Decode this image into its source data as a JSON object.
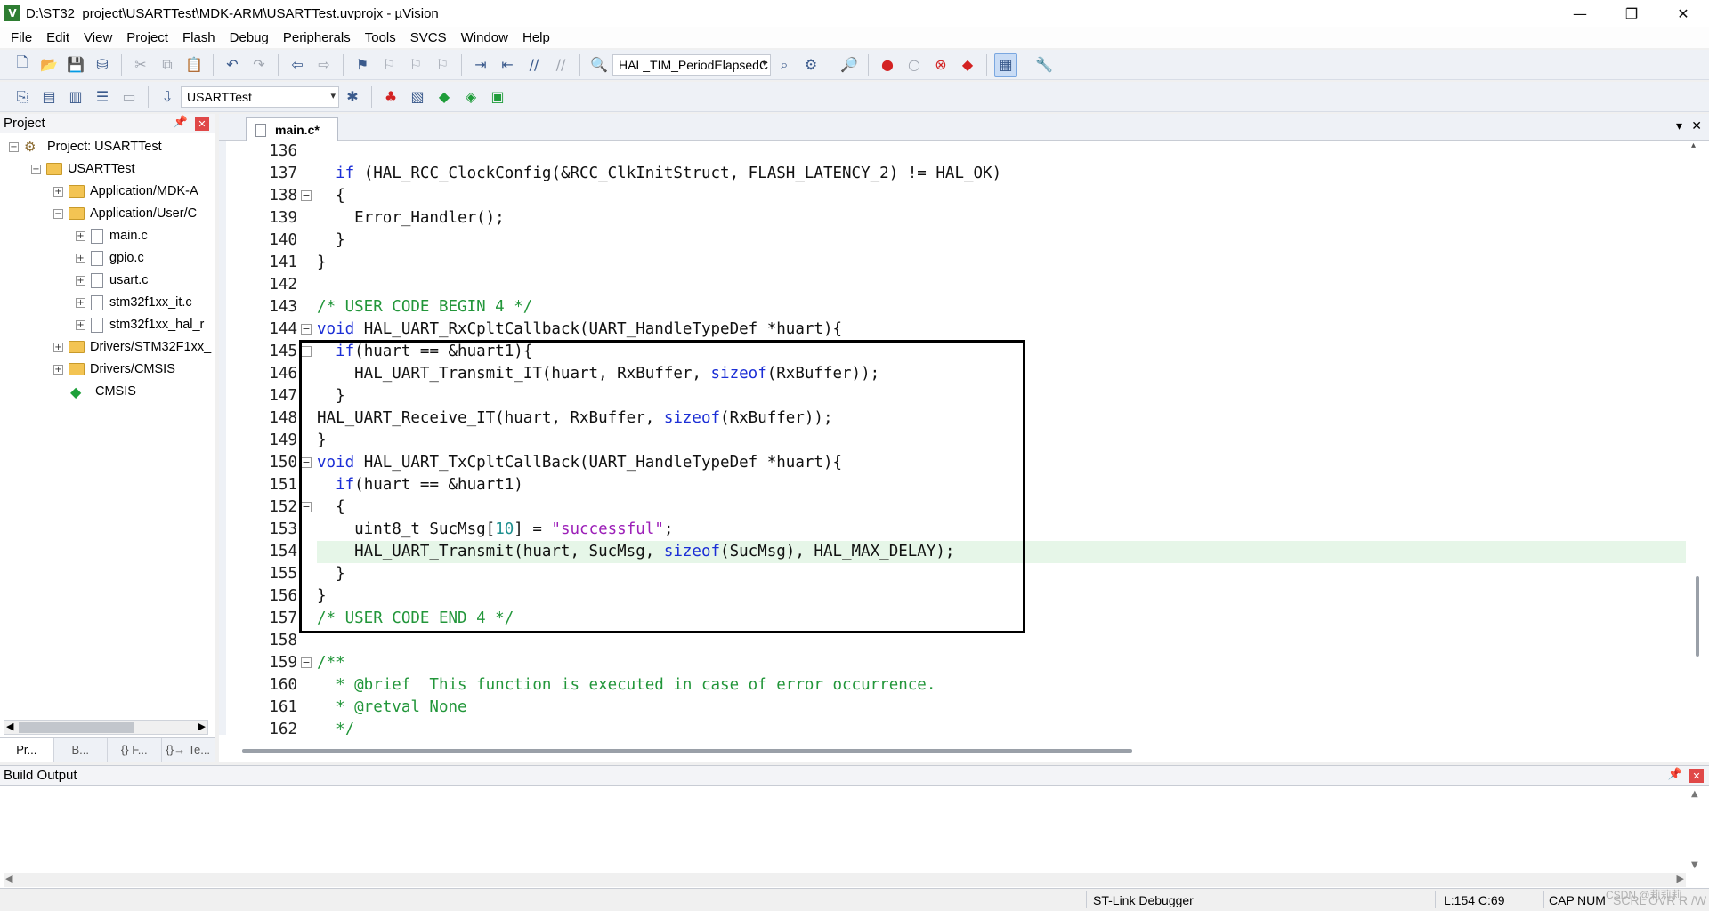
{
  "window": {
    "title": "D:\\ST32_project\\USARTTest\\MDK-ARM\\USARTTest.uvprojx - µVision",
    "app_icon": "V",
    "controls": {
      "minimize": "—",
      "restore": "❐",
      "close": "✕"
    }
  },
  "menu": [
    "File",
    "Edit",
    "View",
    "Project",
    "Flash",
    "Debug",
    "Peripherals",
    "Tools",
    "SVCS",
    "Window",
    "Help"
  ],
  "toolbar1": {
    "function_combo": "HAL_TIM_PeriodElapsedC"
  },
  "toolbar2": {
    "target_combo": "USARTTest"
  },
  "project_panel": {
    "title": "Project",
    "tree": [
      {
        "label": "Project: USARTTest",
        "type": "project"
      },
      {
        "label": "USARTTest",
        "type": "target"
      },
      {
        "label": "Application/MDK-A",
        "type": "folder"
      },
      {
        "label": "Application/User/C",
        "type": "folder"
      },
      {
        "label": "main.c",
        "type": "file"
      },
      {
        "label": "gpio.c",
        "type": "file"
      },
      {
        "label": "usart.c",
        "type": "file"
      },
      {
        "label": "stm32f1xx_it.c",
        "type": "file"
      },
      {
        "label": "stm32f1xx_hal_r",
        "type": "file"
      },
      {
        "label": "Drivers/STM32F1xx_",
        "type": "folder"
      },
      {
        "label": "Drivers/CMSIS",
        "type": "folder"
      },
      {
        "label": "CMSIS",
        "type": "component"
      }
    ],
    "tabs": [
      "Pr...",
      "B...",
      "{} F...",
      "{}→ Te..."
    ]
  },
  "editor": {
    "tab_label": "main.c*",
    "lines": [
      {
        "n": "136",
        "code": ""
      },
      {
        "n": "137",
        "code": "  if (HAL_RCC_ClockConfig(&RCC_ClkInitStruct, FLASH_LATENCY_2) != HAL_OK)"
      },
      {
        "n": "138",
        "code": "  {"
      },
      {
        "n": "139",
        "code": "    Error_Handler();"
      },
      {
        "n": "140",
        "code": "  }"
      },
      {
        "n": "141",
        "code": "}"
      },
      {
        "n": "142",
        "code": ""
      },
      {
        "n": "143",
        "code": "/* USER CODE BEGIN 4 */"
      },
      {
        "n": "144",
        "code": "void HAL_UART_RxCpltCallback(UART_HandleTypeDef *huart){"
      },
      {
        "n": "145",
        "code": "  if(huart == &huart1){"
      },
      {
        "n": "146",
        "code": "    HAL_UART_Transmit_IT(huart, RxBuffer, sizeof(RxBuffer));"
      },
      {
        "n": "147",
        "code": "  }"
      },
      {
        "n": "148",
        "code": "HAL_UART_Receive_IT(huart, RxBuffer, sizeof(RxBuffer));"
      },
      {
        "n": "149",
        "code": "}"
      },
      {
        "n": "150",
        "code": "void HAL_UART_TxCpltCallBack(UART_HandleTypeDef *huart){"
      },
      {
        "n": "151",
        "code": "  if(huart == &huart1)"
      },
      {
        "n": "152",
        "code": "  {"
      },
      {
        "n": "153",
        "code": "    uint8_t SucMsg[10] = \"successful\";"
      },
      {
        "n": "154",
        "code": "    HAL_UART_Transmit(huart, SucMsg, sizeof(SucMsg), HAL_MAX_DELAY);"
      },
      {
        "n": "155",
        "code": "  }"
      },
      {
        "n": "156",
        "code": "}"
      },
      {
        "n": "157",
        "code": "/* USER CODE END 4 */"
      },
      {
        "n": "158",
        "code": ""
      },
      {
        "n": "159",
        "code": "/**"
      },
      {
        "n": "160",
        "code": "  * @brief  This function is executed in case of error occurrence."
      },
      {
        "n": "161",
        "code": "  * @retval None"
      },
      {
        "n": "162",
        "code": "  */"
      }
    ],
    "current_line": "154"
  },
  "build_output": {
    "title": "Build Output"
  },
  "statusbar": {
    "debugger": "ST-Link Debugger",
    "position": "L:154 C:69",
    "cap": "CAP",
    "num": "NUM",
    "scrl": "SCRL",
    "ovr": "OVR",
    "rw": "R /W",
    "watermark": "CSDN @莉莉莉"
  },
  "colors": {
    "keyword": "#1c2fd6",
    "comment": "#22963a",
    "string": "#9c1fb8",
    "number": "#1f8f8f",
    "current_line": "#e6f6e8"
  }
}
